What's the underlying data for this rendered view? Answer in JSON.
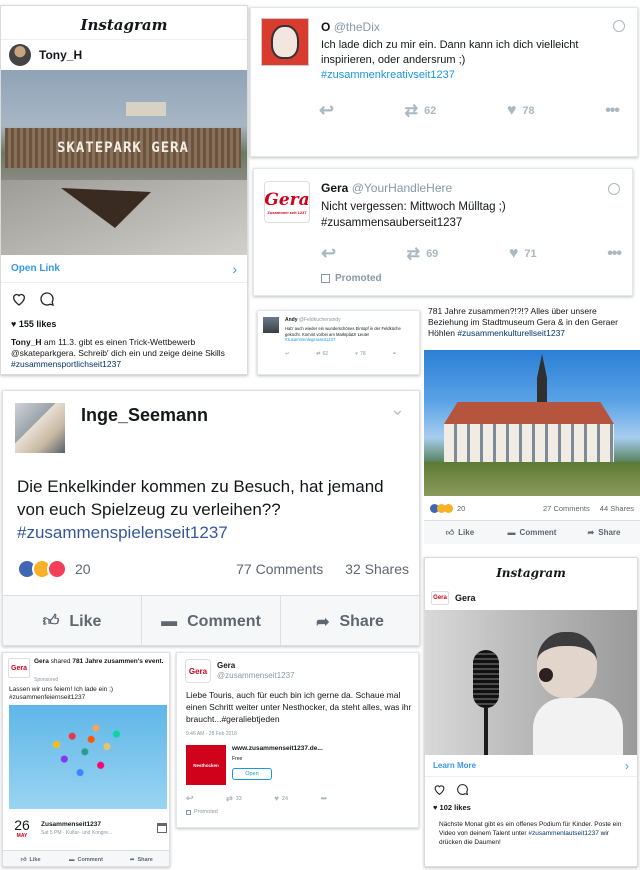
{
  "ig1": {
    "logo": "Instagram",
    "user": "Tony_H",
    "banner_text": "SKATEPARK GERA",
    "open_link": "Open Link",
    "likes": "155 likes",
    "caption_user": "Tony_H",
    "caption": " am 11.3. gibt es einen Trick-Wettbewerb @skateparkgera. Schreib' dich ein und zeige deine Skills ",
    "hashtag": "#zusammensportlichseit1237"
  },
  "tw1": {
    "name": "O",
    "handle": "@theDix",
    "text": "Ich lade dich zu mir ein. Dann kann ich dich vielleicht inspirieren, oder andersrum ;)",
    "hashtag": "#zusammenkreativseit1237",
    "retweets": "62",
    "likes": "78"
  },
  "tw2": {
    "name": "Gera",
    "handle": "@YourHandleHere",
    "text": "Nicht vergessen: Mittwoch Mülltag ;)",
    "hashtag": "#zusammensauberseit1237",
    "retweets": "69",
    "likes": "71",
    "promoted": "Promoted"
  },
  "tw3": {
    "name": "Andy",
    "handle": "@Feldkuchenandy",
    "text": "Hab' auch wieder ein wunderschönes Eintopf in der Feldküche gekocht. Kommt vorbei am Marktplatz! Leute!",
    "hashtag": "#zusammenlegeraseit1237",
    "retweets": "62",
    "likes": "78"
  },
  "fb_museum": {
    "text": "781 Jahre zusammen?!?!? Alles über unsere Beziehung im Stadtmuseum Gera & in den Geraer Höhlen ",
    "hashtag": "#zusammenkulturellseit1237",
    "reactions": "20",
    "comments": "27 Comments",
    "shares": "44 Shares",
    "like": "Like",
    "comment": "Comment",
    "share": "Share"
  },
  "fb_big": {
    "user": "Inge_Seemann",
    "text": "Die Enkelkinder kommen zu Besuch, hat jemand von euch Spielzeug zu verleihen??",
    "hashtag": "#zusammenspielenseit1237",
    "reactions": "20",
    "comments": "77 Comments",
    "shares": "32 Shares",
    "like": "Like",
    "comment": "Comment",
    "share": "Share"
  },
  "ig2": {
    "logo": "Instagram",
    "user": "Gera",
    "learn_more": "Learn More",
    "likes": "102 likes",
    "caption": "Nächste Monat gibt es ein offenes Podium für Kinder. Poste ein Video von deinem Talent unter ",
    "hashtag": "#zusammenlautseit1237",
    "caption_end": " wir drücken die Daumen!"
  },
  "fb_event": {
    "user": "Gera",
    "shared": " shared ",
    "event_name": "781 Jahre zusammen's event.",
    "sponsored": "Sponsored",
    "text": "Lassen wir uns feiern! Ich lade ein ;)",
    "hashtag": "#zusammenfeiernseit1237",
    "day": "26",
    "month": "MAY",
    "title": "Zusammenseit1237",
    "details": "Sat 5 PM · Kultur- und Kongre...",
    "like": "Like",
    "comment": "Comment",
    "share": "Share"
  },
  "tw4": {
    "name": "Gera",
    "handle": "@zusammenseit1237",
    "text": "Liebe Touris, auch für euch bin ich gerne da. Schaue mal einen Schritt weiter unter Nesthocker, da steht alles, was ihr braucht...",
    "hashtag": "#geraliebtjeden",
    "time": "9:46 AM - 28 Feb 2018",
    "app_title": "www.zusammenseit1237.de...",
    "app_price": "Free",
    "app_button": "Open",
    "app_icon_label": "Nesthocken",
    "retweets": "33",
    "likes": "24",
    "promoted": "Promoted"
  },
  "logos": {
    "gera": "Gera",
    "gera_sub": "Zusammen seit 1237"
  }
}
